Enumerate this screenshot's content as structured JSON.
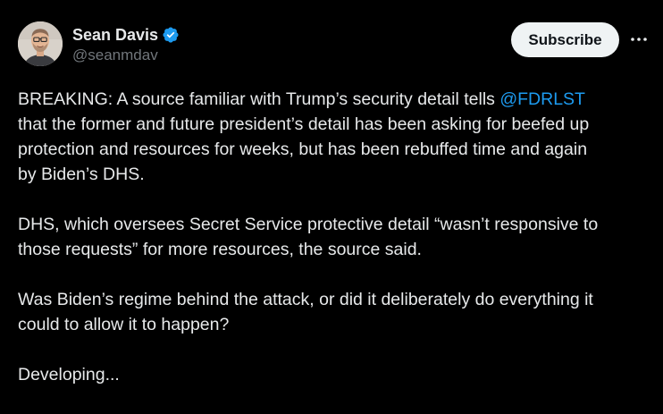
{
  "author": {
    "name": "Sean Davis",
    "handle": "@seanmdav",
    "verified_icon": "verified-badge-icon",
    "verified_color": "#1d9bf0"
  },
  "actions": {
    "subscribe_label": "Subscribe",
    "more_icon": "more-horizontal-icon"
  },
  "tweet": {
    "paragraph1": {
      "line1_pre": "BREAKING: A source familiar with Trump’s security detail tells ",
      "mention": "@FDRLST",
      "line2": "that the former and future president’s detail has been asking for beefed up",
      "line3": "protection and resources for weeks, but has been rebuffed time and again",
      "line4": "by Biden’s DHS."
    },
    "paragraph2": {
      "line1": "DHS, which oversees Secret Service protective detail “wasn’t responsive to",
      "line2": "those requests” for more resources, the source said."
    },
    "paragraph3": {
      "line1": "Was Biden’s regime behind the attack, or did it deliberately do everything it",
      "line2": "could to allow it to happen?"
    },
    "paragraph4": {
      "line1": "Developing..."
    }
  },
  "colors": {
    "background": "#000000",
    "text": "#e7e9ea",
    "secondary_text": "#71767b",
    "link": "#1d9bf0",
    "button_bg": "#eff3f4",
    "button_text": "#0f1419"
  }
}
